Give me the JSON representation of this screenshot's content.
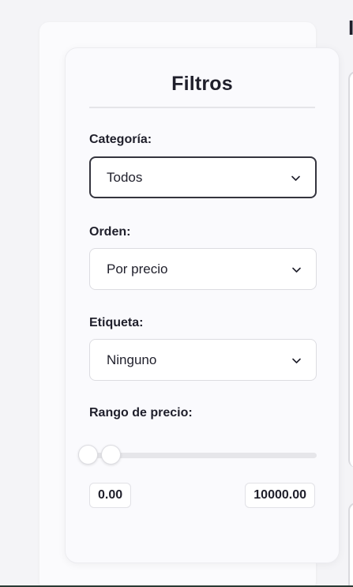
{
  "filters": {
    "title": "Filtros",
    "category": {
      "label": "Categoría:",
      "selected": "Todos",
      "icon": "chevron-down-icon"
    },
    "order": {
      "label": "Orden:",
      "selected": "Por precio",
      "icon": "chevron-down-icon"
    },
    "tag": {
      "label": "Etiqueta:",
      "selected": "Ninguno",
      "icon": "chevron-down-icon"
    },
    "price_range": {
      "label": "Rango de precio:",
      "min_value": "0.00",
      "max_value": "10000.00"
    }
  },
  "colors": {
    "text": "#1f1f2b",
    "card_background": "#fafafd",
    "focus_border": "#34343e",
    "track": "#e6e6ea"
  }
}
